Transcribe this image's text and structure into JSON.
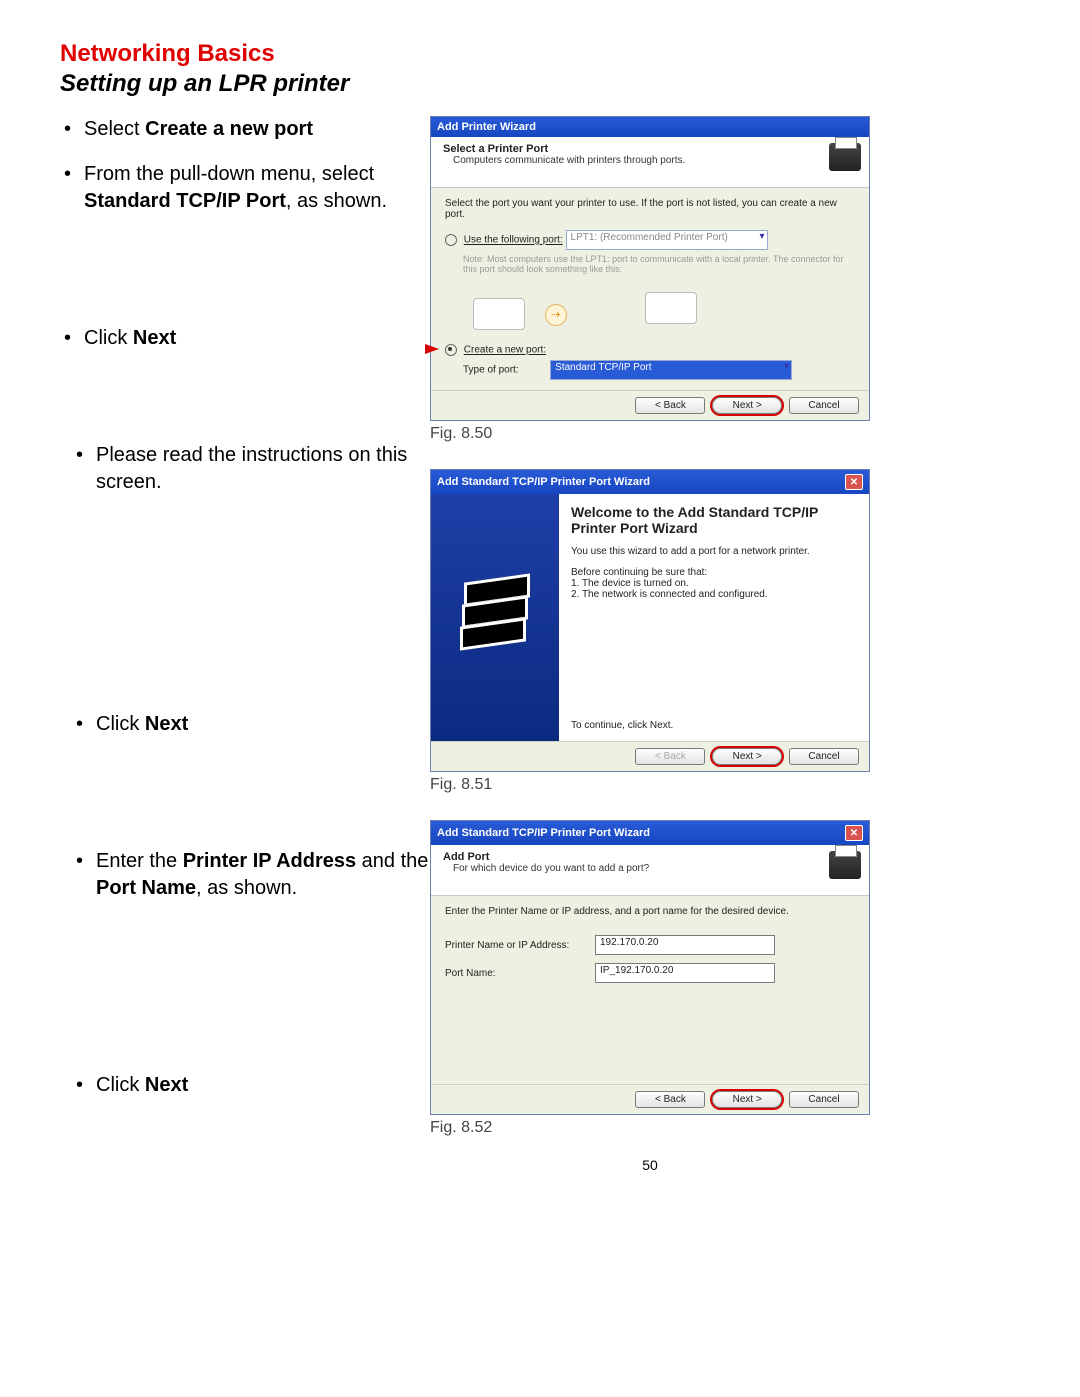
{
  "heading": "Networking Basics",
  "subheading": "Setting up an LPR printer",
  "bullets": {
    "b1a": "Select ",
    "b1b": "Create a new port",
    "b2a": "From the pull-down menu, select ",
    "b2b": "Standard TCP/IP Port",
    "b2c": ", as shown.",
    "b3a": "Click ",
    "b3b": "Next",
    "b4": "Please read the instructions on this screen.",
    "b5a": "Click ",
    "b5b": "Next",
    "b6a": "Enter the ",
    "b6b": "Printer IP Address",
    "b6c": " and the ",
    "b6d": "Port Name",
    "b6e": ", as shown.",
    "b7a": "Click ",
    "b7b": "Next"
  },
  "fig1": {
    "caption": "Fig. 8.50",
    "title": "Add Printer Wizard",
    "header_title": "Select a Printer Port",
    "header_sub": "Computers communicate with printers through ports.",
    "body_intro": "Select the port you want your printer to use. If the port is not listed, you can create a new port.",
    "radio_use": "Use the following port:",
    "use_value": "LPT1: (Recommended Printer Port)",
    "note": "Note: Most computers use the LPT1: port to communicate with a local printer. The connector for this port should look something like this:",
    "radio_create": "Create a new port:",
    "type_label": "Type of port:",
    "type_value": "Standard TCP/IP Port",
    "back": "< Back",
    "next": "Next >",
    "cancel": "Cancel"
  },
  "fig2": {
    "caption": "Fig. 8.51",
    "title": "Add Standard TCP/IP Printer Port Wizard",
    "welcome_title": "Welcome to the Add Standard TCP/IP Printer Port Wizard",
    "welcome_p1": "You use this wizard to add a port for a network printer.",
    "welcome_p2a": "Before continuing be sure that:",
    "welcome_p2b": "1.  The device is turned on.",
    "welcome_p2c": "2.  The network is connected and configured.",
    "cont": "To continue, click Next.",
    "back": "< Back",
    "next": "Next >",
    "cancel": "Cancel"
  },
  "fig3": {
    "caption": "Fig. 8.52",
    "title": "Add Standard TCP/IP Printer Port Wizard",
    "header_title": "Add Port",
    "header_sub": "For which device do you want to add a port?",
    "body_intro": "Enter the Printer Name or IP address, and a port name for the desired device.",
    "label_addr": "Printer Name or IP Address:",
    "val_addr": "192.170.0.20",
    "label_port": "Port Name:",
    "val_port": "IP_192.170.0.20",
    "back": "< Back",
    "next": "Next >",
    "cancel": "Cancel"
  },
  "page_number": "50"
}
